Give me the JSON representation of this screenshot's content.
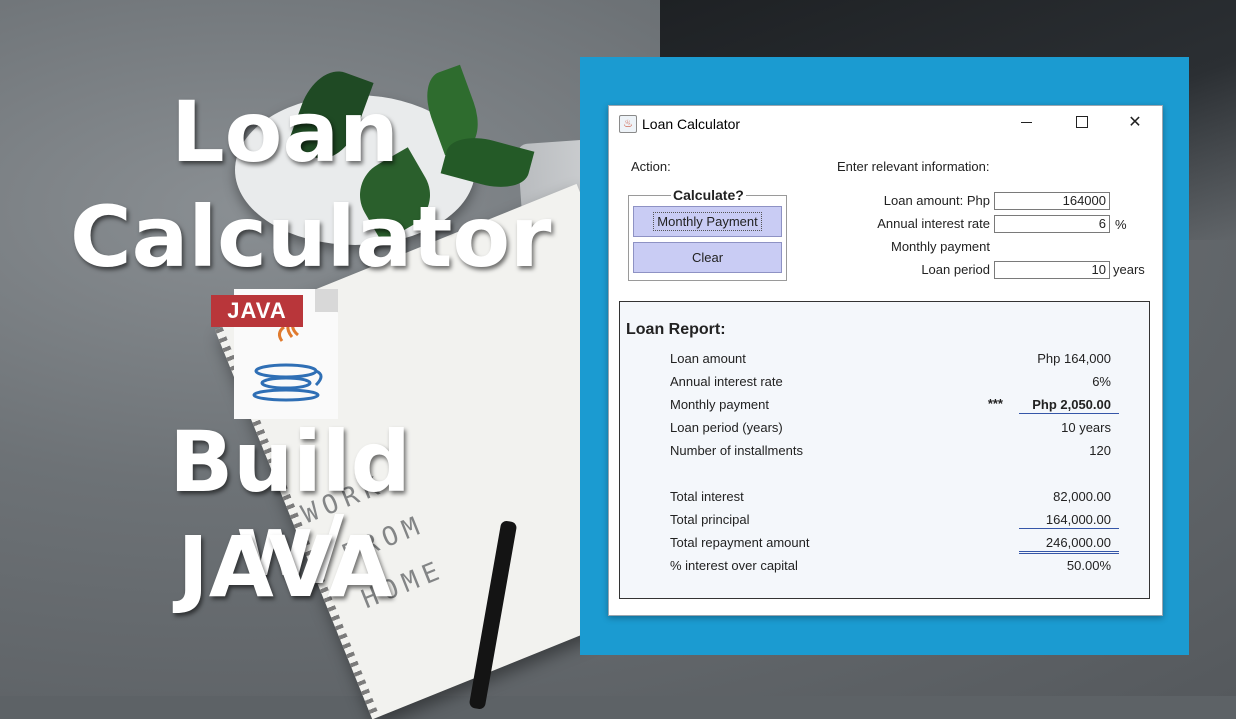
{
  "headline": {
    "line1": "Loan",
    "line2": "Calculator",
    "line3": "Build w/",
    "line4": "JAVA"
  },
  "java_badge": "JAVA",
  "notebook_text": {
    "line1": "WORK",
    "line2": "FROM",
    "line3": "HOME"
  },
  "window": {
    "title": "Loan Calculator",
    "controls": {
      "minimize": "minimize",
      "maximize": "maximize",
      "close": "✕"
    }
  },
  "form": {
    "action_label": "Action:",
    "info_label": "Enter relevant information:",
    "group_title": "Calculate?",
    "monthly_button": "Monthly Payment",
    "clear_button": "Clear",
    "loan_amount_label": "Loan amount: Php",
    "loan_amount_value": "164000",
    "interest_label": "Annual interest rate",
    "interest_value": "6",
    "interest_unit": "%",
    "monthly_label": "Monthly payment",
    "period_label": "Loan period",
    "period_value": "10",
    "period_unit": "years"
  },
  "report": {
    "title": "Loan Report:",
    "rows": [
      {
        "label": "Loan amount",
        "value": "Php 164,000"
      },
      {
        "label": "Annual interest rate",
        "value": "6%"
      },
      {
        "label": "Monthly payment",
        "value": "Php 2,050.00",
        "marker": "***"
      },
      {
        "label": "Loan period (years)",
        "value": "10 years"
      },
      {
        "label": "Number of installments",
        "value": "120"
      },
      {
        "label": "Total interest",
        "value": "82,000.00"
      },
      {
        "label": "Total principal",
        "value": "164,000.00"
      },
      {
        "label": "Total repayment amount",
        "value": "246,000.00"
      },
      {
        "label": "% interest over capital",
        "value": "50.00%"
      }
    ]
  },
  "colors": {
    "frame": "#1b9bd1",
    "button": "#c9ccf4",
    "java_badge": "#b9363a"
  }
}
